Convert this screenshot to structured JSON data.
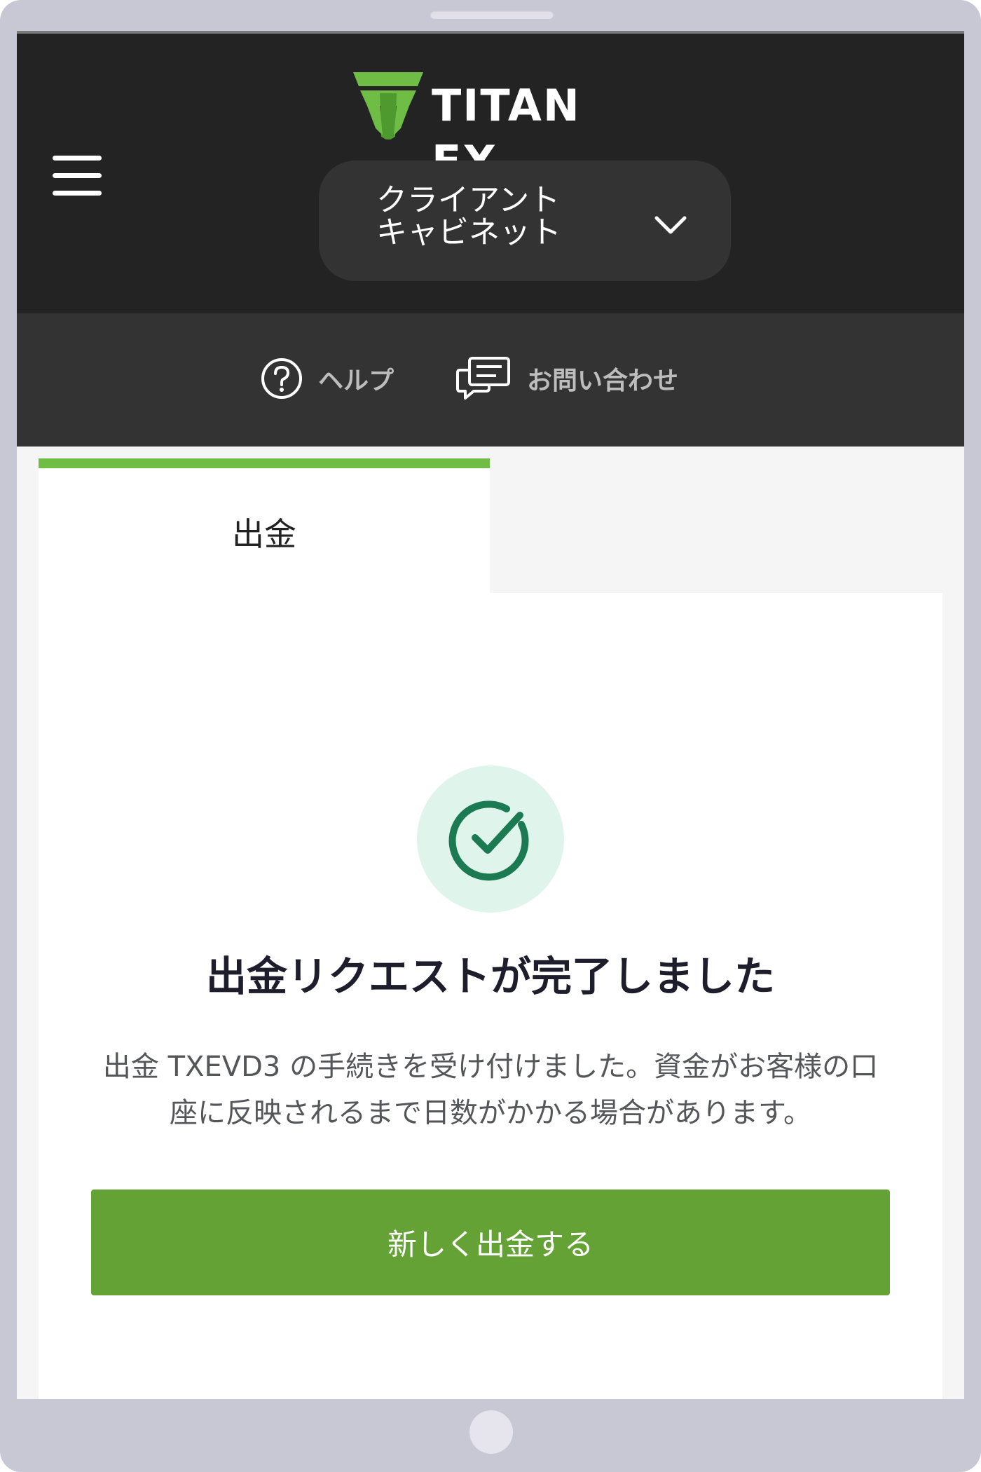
{
  "header": {
    "logo_text": "TITAN FX",
    "portal_selector": {
      "line1": "クライアント",
      "line2": "キャビネット"
    }
  },
  "subnav": {
    "help_label": "ヘルプ",
    "contact_label": "お問い合わせ"
  },
  "tabs": [
    {
      "label": "出金",
      "active": true
    }
  ],
  "result": {
    "title": "出金リクエストが完了しました",
    "message_line1": "出金 TXEVD3 の手続きを受け付けました。資金がお客様の口",
    "message_line2": "座に反映されるまで日数がかかる場合があります。",
    "button_label": "新しく出金する"
  },
  "colors": {
    "brand_green": "#6fbd45",
    "button_green": "#65a236",
    "success_green": "#1c7a52",
    "header_bg": "#232323"
  }
}
